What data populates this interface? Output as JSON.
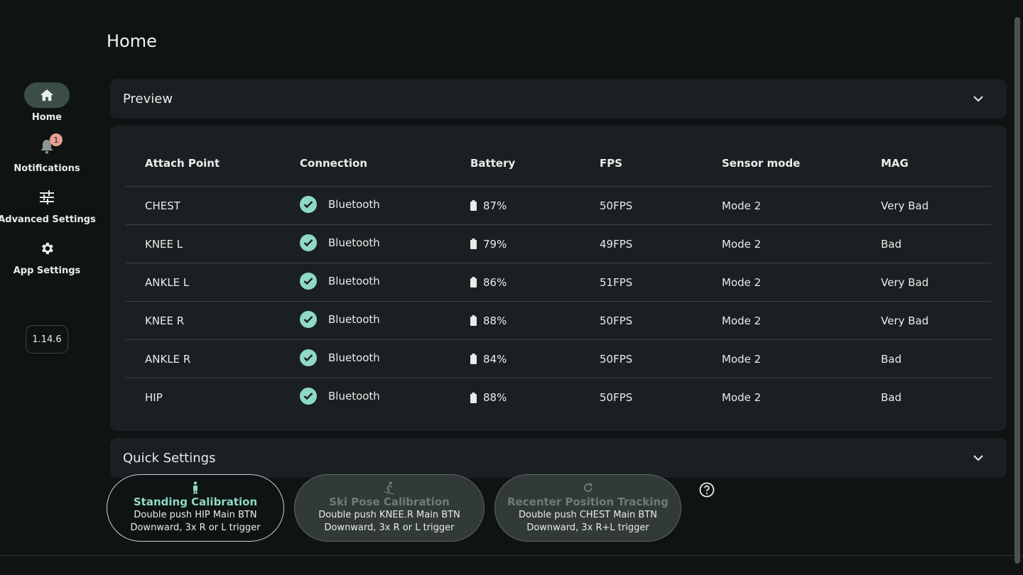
{
  "page": {
    "title": "Home"
  },
  "sidebar": {
    "items": [
      {
        "label": "Home",
        "icon": "home-icon",
        "active": true
      },
      {
        "label": "Notifications",
        "icon": "bell-icon",
        "badge": "1"
      },
      {
        "label": "Advanced Settings",
        "icon": "sliders-icon"
      },
      {
        "label": "App Settings",
        "icon": "gear-icon"
      }
    ],
    "version": "1.14.6"
  },
  "preview": {
    "title": "Preview"
  },
  "table": {
    "headers": [
      "Attach Point",
      "Connection",
      "Battery",
      "FPS",
      "Sensor mode",
      "MAG"
    ],
    "rows": [
      {
        "attach": "CHEST",
        "connection": "Bluetooth",
        "battery": "87%",
        "fps": "50FPS",
        "mode": "Mode 2",
        "mag": "Very Bad"
      },
      {
        "attach": "KNEE L",
        "connection": "Bluetooth",
        "battery": "79%",
        "fps": "49FPS",
        "mode": "Mode 2",
        "mag": "Bad"
      },
      {
        "attach": "ANKLE L",
        "connection": "Bluetooth",
        "battery": "86%",
        "fps": "51FPS",
        "mode": "Mode 2",
        "mag": "Very Bad"
      },
      {
        "attach": "KNEE R",
        "connection": "Bluetooth",
        "battery": "88%",
        "fps": "50FPS",
        "mode": "Mode 2",
        "mag": "Very Bad"
      },
      {
        "attach": "ANKLE R",
        "connection": "Bluetooth",
        "battery": "84%",
        "fps": "50FPS",
        "mode": "Mode 2",
        "mag": "Bad"
      },
      {
        "attach": "HIP",
        "connection": "Bluetooth",
        "battery": "88%",
        "fps": "50FPS",
        "mode": "Mode 2",
        "mag": "Bad"
      }
    ]
  },
  "quick_settings": {
    "title": "Quick Settings"
  },
  "calibration": {
    "standing": {
      "title": "Standing Calibration",
      "line1": "Double push HIP Main BTN",
      "line2": "Downward, 3x R or L trigger"
    },
    "ski": {
      "title": "Ski Pose Calibration",
      "line1": "Double push KNEE.R Main BTN",
      "line2": "Downward, 3x R or L trigger"
    },
    "recenter": {
      "title": "Recenter Position Tracking",
      "line1": "Double push CHEST Main BTN",
      "line2": "Downward, 3x R+L trigger"
    }
  },
  "colors": {
    "background": "#0f1314",
    "card": "#1a2021",
    "accent": "#8fd9c3",
    "active_nav": "#3a4d48",
    "badge": "#e8a093"
  }
}
